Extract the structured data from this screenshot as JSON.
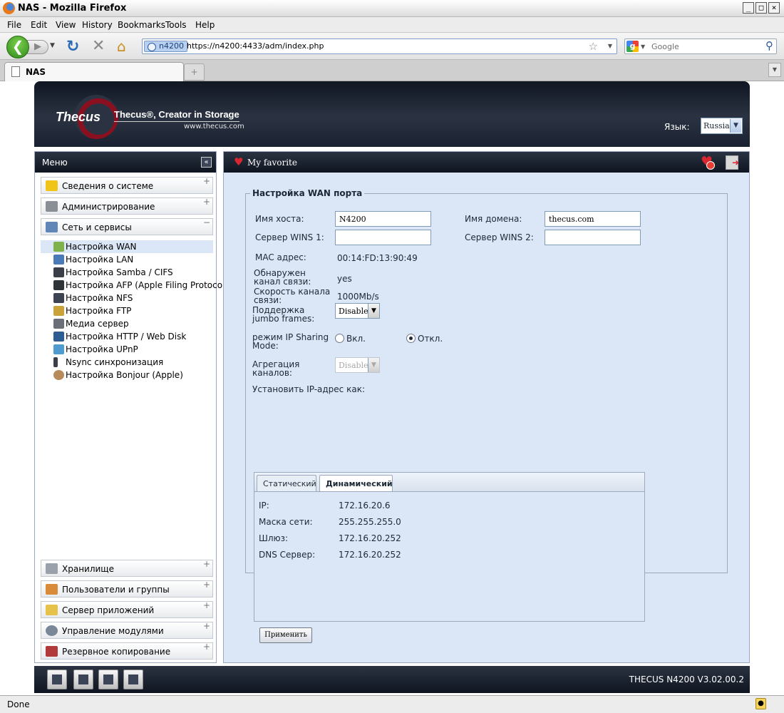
{
  "browser": {
    "window_title": "NAS - Mozilla Firefox",
    "menu": [
      "File",
      "Edit",
      "View",
      "History",
      "Bookmarks",
      "Tools",
      "Help"
    ],
    "site_badge": "n4200",
    "url": "https://n4200:4433/adm/index.php",
    "search_placeholder": "Google",
    "tab_title": "NAS",
    "status": "Done"
  },
  "header": {
    "logo": "Thecus",
    "brand": "Thecus®, Creator in Storage",
    "brand_url": "www.thecus.com",
    "lang_label": "Язык:",
    "lang_value": "Russia"
  },
  "menu": {
    "title": "Меню",
    "categories_top": [
      {
        "label": "Сведения о системе",
        "icon": "info-icon",
        "toggle": "+"
      },
      {
        "label": "Администрирование",
        "icon": "tools-icon",
        "toggle": "+"
      },
      {
        "label": "Сеть и сервисы",
        "icon": "network-icon",
        "toggle": "−"
      }
    ],
    "network_items": [
      {
        "label": "Настройка WAN",
        "icon": "wan-icon"
      },
      {
        "label": "Настройка LAN",
        "icon": "lan-icon"
      },
      {
        "label": "Настройка Samba / CIFS",
        "icon": "samba-icon"
      },
      {
        "label": "Настройка AFP (Apple Filing Protocol)",
        "icon": "afp-icon"
      },
      {
        "label": "Настройка NFS",
        "icon": "nfs-icon"
      },
      {
        "label": "Настройка FTP",
        "icon": "ftp-icon"
      },
      {
        "label": "Медиа сервер",
        "icon": "media-icon"
      },
      {
        "label": "Настройка HTTP / Web Disk",
        "icon": "http-icon"
      },
      {
        "label": "Настройка UPnP",
        "icon": "upnp-icon"
      },
      {
        "label": "Nsync синхронизация",
        "icon": "nsync-icon"
      },
      {
        "label": "Настройка Bonjour (Apple)",
        "icon": "bonjour-icon"
      }
    ],
    "categories_bottom": [
      {
        "label": "Хранилище",
        "icon": "storage-icon",
        "toggle": "+"
      },
      {
        "label": "Пользователи и группы",
        "icon": "users-icon",
        "toggle": "+"
      },
      {
        "label": "Сервер приложений",
        "icon": "app-server-icon",
        "toggle": "+"
      },
      {
        "label": "Управление модулями",
        "icon": "modules-icon",
        "toggle": "+"
      },
      {
        "label": "Резервное копирование",
        "icon": "backup-icon",
        "toggle": "+"
      }
    ]
  },
  "favorites": {
    "label": "My favorite"
  },
  "wan": {
    "legend": "Настройка WAN порта",
    "hostname_label": "Имя хоста:",
    "hostname_value": "N4200",
    "domain_label": "Имя домена:",
    "domain_value": "thecus.com",
    "wins1_label": "Сервер WINS 1:",
    "wins1_value": "",
    "wins2_label": "Сервер WINS 2:",
    "wins2_value": "",
    "mac_label": "MAC адрес:",
    "mac_value": "00:14:FD:13:90:49",
    "link_label": "Обнаружен канал связи:",
    "link_value": "yes",
    "speed_label": "Скорость канала связи:",
    "speed_value": "1000Mb/s",
    "jumbo_label": "Поддержка jumbo frames:",
    "jumbo_value": "Disable",
    "ipsharing_label": "режим IP Sharing Mode:",
    "ipsharing_on": "Вкл.",
    "ipsharing_off": "Откл.",
    "ipsharing_selected": "off",
    "aggregation_label": "Агрегация каналов:",
    "aggregation_value": "Disable",
    "set_ip_label": "Установить IP-адрес как:",
    "tabs": [
      "Статический",
      "Динамический"
    ],
    "active_tab": "Динамический",
    "ip_label": "IP:",
    "ip_value": "172.16.20.6",
    "mask_label": "Маска сети:",
    "mask_value": "255.255.255.0",
    "gateway_label": "Шлюз:",
    "gateway_value": "172.16.20.252",
    "dns_label": "DNS Сервер:",
    "dns_value": "172.16.20.252",
    "apply": "Применить"
  },
  "footer": {
    "version": "THECUS N4200 V3.02.00.2"
  }
}
